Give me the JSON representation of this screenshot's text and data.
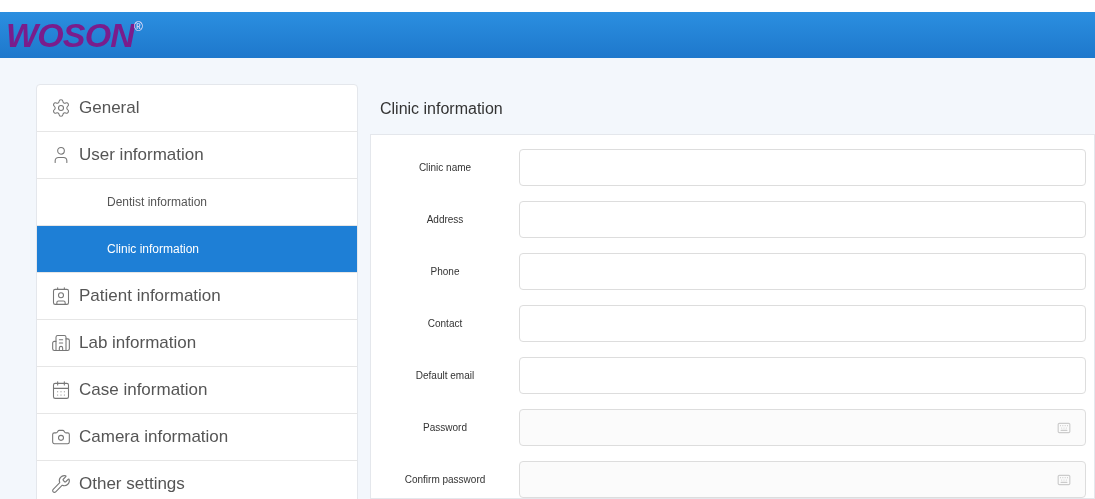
{
  "header": {
    "logo": "WOSON",
    "mark": "®"
  },
  "sidebar": {
    "items": [
      {
        "label": "General",
        "kind": "section",
        "selected": false
      },
      {
        "label": "User information",
        "kind": "section",
        "selected": false
      },
      {
        "label": "Dentist information",
        "kind": "sub",
        "selected": false
      },
      {
        "label": "Clinic information",
        "kind": "sub",
        "selected": true
      },
      {
        "label": "Patient information",
        "kind": "section",
        "selected": false
      },
      {
        "label": "Lab information",
        "kind": "section",
        "selected": false
      },
      {
        "label": "Case information",
        "kind": "section",
        "selected": false
      },
      {
        "label": "Camera information",
        "kind": "section",
        "selected": false
      },
      {
        "label": "Other settings",
        "kind": "section",
        "selected": false
      }
    ]
  },
  "panel": {
    "title": "Clinic information",
    "fields": [
      {
        "label": "Clinic name",
        "kind": "text"
      },
      {
        "label": "Address",
        "kind": "text"
      },
      {
        "label": "Phone",
        "kind": "text"
      },
      {
        "label": "Contact",
        "kind": "text"
      },
      {
        "label": "Default email",
        "kind": "text"
      },
      {
        "label": "Password",
        "kind": "password"
      },
      {
        "label": "Confirm password",
        "kind": "password"
      }
    ]
  }
}
